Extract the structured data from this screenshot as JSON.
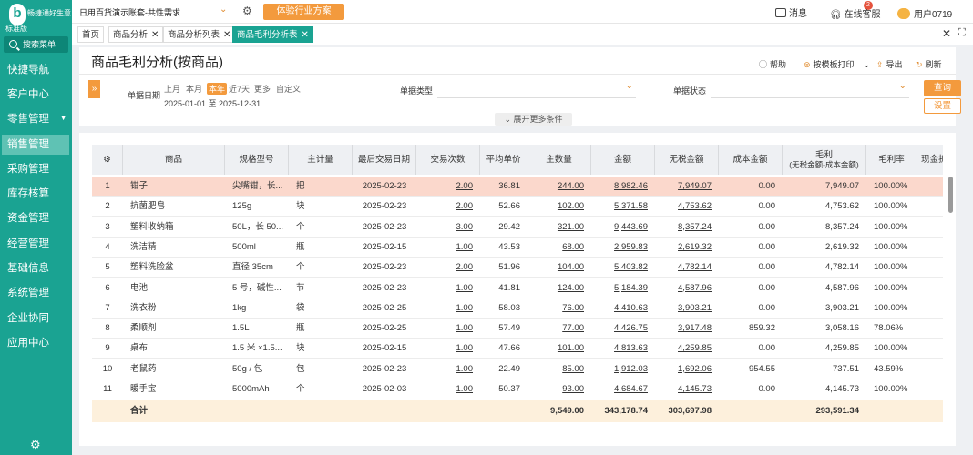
{
  "brand": {
    "logo_char": "b",
    "name": "畅捷通好生意",
    "edition": "标准版"
  },
  "sidebar": {
    "search_label": "搜索菜单",
    "items": [
      {
        "label": "快捷导航"
      },
      {
        "label": "客户中心"
      },
      {
        "label": "零售管理",
        "has_children": true
      },
      {
        "label": "销售管理",
        "active": true
      },
      {
        "label": "采购管理"
      },
      {
        "label": "库存核算"
      },
      {
        "label": "资金管理"
      },
      {
        "label": "经营管理"
      },
      {
        "label": "基础信息"
      },
      {
        "label": "系统管理"
      },
      {
        "label": "企业协同"
      },
      {
        "label": "应用中心"
      }
    ]
  },
  "topbar": {
    "account": "日用百货演示账套-共性需求",
    "trial_button": "体验行业方案",
    "messages_label": "消息",
    "messages_count": "2",
    "service_label": "在线客服",
    "user_label": "用户0719"
  },
  "tabs": [
    {
      "label": "首页",
      "closable": false
    },
    {
      "label": "商品分析",
      "closable": true
    },
    {
      "label": "商品分析列表",
      "closable": true
    },
    {
      "label": "商品毛利分析表",
      "closable": true,
      "active": true
    }
  ],
  "page": {
    "title": "商品毛利分析(按商品)",
    "actions": {
      "help": "帮助",
      "print": "按模板打印",
      "export": "导出",
      "refresh": "刷新"
    }
  },
  "filters": {
    "date_label": "单据日期",
    "date_options": [
      "上月",
      "本月",
      "本年",
      "近7天",
      "更多",
      "自定义"
    ],
    "date_selected": "本年",
    "date_range": "2025-01-01 至 2025-12-31",
    "doc_type_label": "单据类型",
    "doc_status_label": "单据状态",
    "query_button": "查询",
    "settings_button": "设置",
    "more_conditions": "展开更多条件"
  },
  "table": {
    "columns": {
      "name": "商品",
      "spec": "规格型号",
      "unit": "主计量",
      "last_date": "最后交易日期",
      "tx_count": "交易次数",
      "avg_price": "平均单价",
      "qty": "主数量",
      "amount": "金额",
      "amount_ex_tax": "无税金额",
      "cost": "成本金额",
      "profit": "毛利",
      "profit_note": "(无税金额-成本金额)",
      "margin": "毛利率",
      "cash_discount": "现金折扣"
    },
    "rows": [
      {
        "no": "1",
        "name": "钳子",
        "spec": "尖嘴钳，长...",
        "unit": "把",
        "last_date": "2025-02-23",
        "tx_count": "2.00",
        "avg_price": "36.81",
        "qty": "244.00",
        "amount": "8,982.46",
        "amount_ex_tax": "7,949.07",
        "cost": "0.00",
        "profit": "7,949.07",
        "margin": "100.00%",
        "selected": true
      },
      {
        "no": "2",
        "name": "抗菌肥皂",
        "spec": "125g",
        "unit": "块",
        "last_date": "2025-02-23",
        "tx_count": "2.00",
        "avg_price": "52.66",
        "qty": "102.00",
        "amount": "5,371.58",
        "amount_ex_tax": "4,753.62",
        "cost": "0.00",
        "profit": "4,753.62",
        "margin": "100.00%"
      },
      {
        "no": "3",
        "name": "塑料收纳箱",
        "spec": "50L，长 50...",
        "unit": "个",
        "last_date": "2025-02-23",
        "tx_count": "3.00",
        "avg_price": "29.42",
        "qty": "321.00",
        "amount": "9,443.69",
        "amount_ex_tax": "8,357.24",
        "cost": "0.00",
        "profit": "8,357.24",
        "margin": "100.00%"
      },
      {
        "no": "4",
        "name": "洗洁精",
        "spec": "500ml",
        "unit": "瓶",
        "last_date": "2025-02-15",
        "tx_count": "1.00",
        "avg_price": "43.53",
        "qty": "68.00",
        "amount": "2,959.83",
        "amount_ex_tax": "2,619.32",
        "cost": "0.00",
        "profit": "2,619.32",
        "margin": "100.00%"
      },
      {
        "no": "5",
        "name": "塑料洗脸盆",
        "spec": "直径 35cm",
        "unit": "个",
        "last_date": "2025-02-23",
        "tx_count": "2.00",
        "avg_price": "51.96",
        "qty": "104.00",
        "amount": "5,403.82",
        "amount_ex_tax": "4,782.14",
        "cost": "0.00",
        "profit": "4,782.14",
        "margin": "100.00%"
      },
      {
        "no": "6",
        "name": "电池",
        "spec": "5 号，碱性...",
        "unit": "节",
        "last_date": "2025-02-23",
        "tx_count": "1.00",
        "avg_price": "41.81",
        "qty": "124.00",
        "amount": "5,184.39",
        "amount_ex_tax": "4,587.96",
        "cost": "0.00",
        "profit": "4,587.96",
        "margin": "100.00%"
      },
      {
        "no": "7",
        "name": "洗衣粉",
        "spec": "1kg",
        "unit": "袋",
        "last_date": "2025-02-25",
        "tx_count": "1.00",
        "avg_price": "58.03",
        "qty": "76.00",
        "amount": "4,410.63",
        "amount_ex_tax": "3,903.21",
        "cost": "0.00",
        "profit": "3,903.21",
        "margin": "100.00%"
      },
      {
        "no": "8",
        "name": "柔顺剂",
        "spec": "1.5L",
        "unit": "瓶",
        "last_date": "2025-02-25",
        "tx_count": "1.00",
        "avg_price": "57.49",
        "qty": "77.00",
        "amount": "4,426.75",
        "amount_ex_tax": "3,917.48",
        "cost": "859.32",
        "profit": "3,058.16",
        "margin": "78.06%"
      },
      {
        "no": "9",
        "name": "桌布",
        "spec": "1.5 米 ×1.5...",
        "unit": "块",
        "last_date": "2025-02-15",
        "tx_count": "1.00",
        "avg_price": "47.66",
        "qty": "101.00",
        "amount": "4,813.63",
        "amount_ex_tax": "4,259.85",
        "cost": "0.00",
        "profit": "4,259.85",
        "margin": "100.00%"
      },
      {
        "no": "10",
        "name": "老鼠药",
        "spec": "50g / 包",
        "unit": "包",
        "last_date": "2025-02-23",
        "tx_count": "1.00",
        "avg_price": "22.49",
        "qty": "85.00",
        "amount": "1,912.03",
        "amount_ex_tax": "1,692.06",
        "cost": "954.55",
        "profit": "737.51",
        "margin": "43.59%"
      },
      {
        "no": "11",
        "name": "暖手宝",
        "spec": "5000mAh",
        "unit": "个",
        "last_date": "2025-02-03",
        "tx_count": "1.00",
        "avg_price": "50.37",
        "qty": "93.00",
        "amount": "4,684.67",
        "amount_ex_tax": "4,145.73",
        "cost": "0.00",
        "profit": "4,145.73",
        "margin": "100.00%"
      }
    ],
    "totals": {
      "label": "合计",
      "qty": "9,549.00",
      "amount": "343,178.74",
      "amount_ex_tax": "303,697.98",
      "profit": "293,591.34"
    }
  },
  "colors": {
    "sidebar": "#1aa392",
    "accent": "#f39a3d",
    "selected_row": "#fbd8cc",
    "total_row": "#fdf0dc"
  }
}
